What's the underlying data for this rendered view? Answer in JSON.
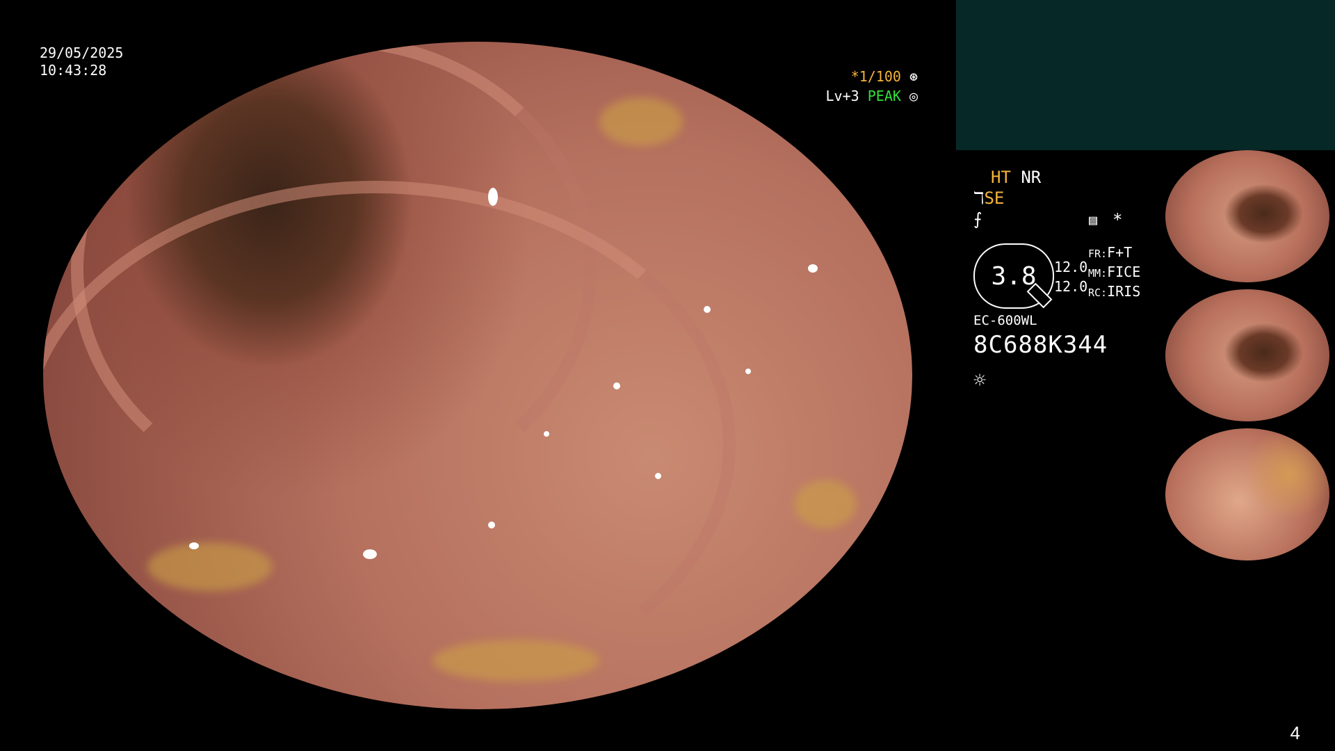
{
  "timestamp": {
    "date": "29/05/2025",
    "time": "10:43:28"
  },
  "osd": {
    "shutter": "*1/100",
    "level": "Lv+3",
    "mode": "PEAK"
  },
  "panel": {
    "ht": "HT",
    "nr": "NR",
    "se": "SE",
    "gauge_value": "3.8",
    "gauge_top": "12.0",
    "gauge_bottom": "12.0",
    "fr_key": "FR:",
    "fr_val": "F+T",
    "mm_key": "MM:",
    "mm_val": "FICE",
    "rc_key": "RC:",
    "rc_val": "IRIS",
    "model": "EC-600WL",
    "serial": "8C688K344"
  },
  "icons": [
    "shutter-icon",
    "peak-icon",
    "enhance-icon",
    "structure-icon",
    "memo-icon",
    "asterisk-icon",
    "light-icon"
  ],
  "page_number": "4",
  "colors": {
    "accent_orange": "#f5b43a",
    "accent_green": "#33e03a",
    "panel_bg": "#062826"
  }
}
